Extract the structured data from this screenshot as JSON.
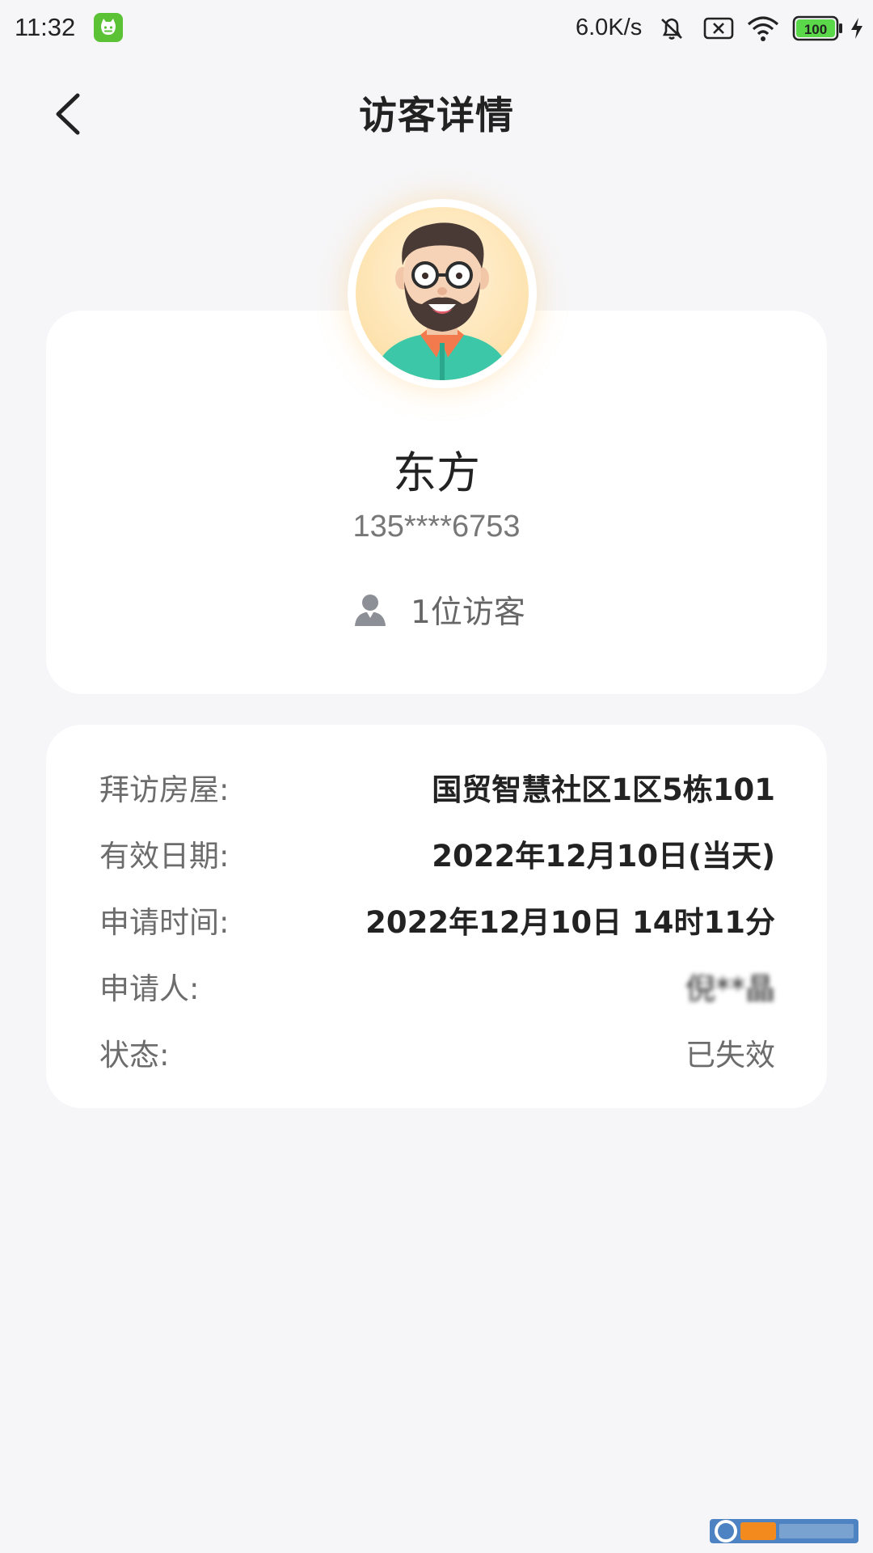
{
  "status_bar": {
    "time": "11:32",
    "speed": "6.0K/s",
    "battery": "100",
    "icons": [
      "cat-app-icon",
      "mute-bell-icon",
      "sim-x-icon",
      "wifi-icon",
      "battery-icon",
      "charging-icon"
    ]
  },
  "header": {
    "title": "访客详情",
    "back_icon": "chevron-left-icon"
  },
  "profile": {
    "name": "东方",
    "phone": "135****6753",
    "visitor_count": "1位访客",
    "avatar": "avatar-icon",
    "count_icon": "person-icon"
  },
  "details": {
    "rows": [
      {
        "label": "拜访房屋:",
        "value": "国贸智慧社区1区5栋101"
      },
      {
        "label": "有效日期:",
        "value": "2022年12月10日(当天)"
      },
      {
        "label": "申请时间:",
        "value": "2022年12月10日 14时11分"
      },
      {
        "label": "申请人:",
        "value": "倪**晶"
      },
      {
        "label": "状态:",
        "value": "已失效"
      }
    ]
  },
  "colors": {
    "background": "#f6f6f8",
    "card": "#ffffff",
    "title": "#222222",
    "label": "#6c6c6c",
    "badge_green": "#5bc236"
  }
}
